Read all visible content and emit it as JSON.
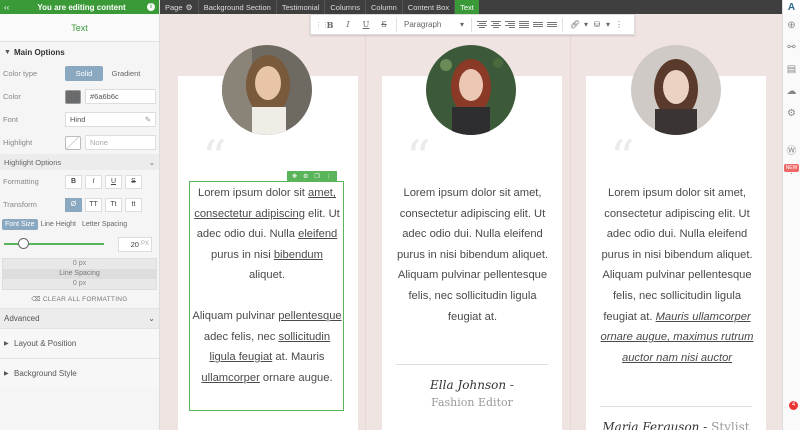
{
  "editing_bar": {
    "text": "You are editing content"
  },
  "panel": {
    "title": "Text",
    "main_options": "Main Options",
    "color_type_label": "Color type",
    "color_type_solid": "Solid",
    "color_type_gradient": "Gradient",
    "color_label": "Color",
    "color_value": "#6a6b6c",
    "font_label": "Font",
    "font_value": "Hind",
    "highlight_label": "Highlight",
    "highlight_value": "None",
    "highlight_options": "Highlight Options",
    "formatting_label": "Formatting",
    "formatting_buttons": [
      "B",
      "I",
      "U",
      "S"
    ],
    "transform_label": "Transform",
    "transform_buttons": [
      "Ø",
      "TT",
      "Tt",
      "tt"
    ],
    "tab_font_size": "Font Size",
    "tab_line_height": "Line Height",
    "tab_letter_spacing": "Letter Spacing",
    "font_size_value": "20",
    "font_size_unit": "PX",
    "spacing_top": "0 px",
    "line_spacing": "Line Spacing",
    "spacing_bottom": "0 px",
    "clear_formatting": "CLEAR ALL FORMATTING",
    "advanced": "Advanced",
    "layout_position": "Layout & Position",
    "background_style": "Background Style"
  },
  "breadcrumb": {
    "items": [
      "Page",
      "Background Section",
      "Testimonial",
      "Columns",
      "Column",
      "Content Box",
      "Text"
    ]
  },
  "text_toolbar": {
    "buttons": [
      "B",
      "I",
      "U",
      "S"
    ],
    "paragraph": "Paragraph"
  },
  "testimonials": [
    {
      "segments": [
        {
          "t": "Lorem ipsum dolor sit "
        },
        {
          "t": "amet,",
          "u": true
        },
        {
          "t": " "
        },
        {
          "t": "consectetur adipiscing",
          "u": true
        },
        {
          "t": " elit. Ut adec odio dui. Nulla "
        },
        {
          "t": "eleifend",
          "u": true
        },
        {
          "t": " purus in nisi "
        },
        {
          "t": "bibendum",
          "u": true
        },
        {
          "t": " aliquet."
        }
      ],
      "segments2": [
        {
          "t": "Aliquam pulvinar "
        },
        {
          "t": "pellentesque",
          "u": true
        },
        {
          "t": " adec felis, nec "
        },
        {
          "t": "sollicitudin ligula feugiat",
          "u": true
        },
        {
          "t": " at. Mauris "
        },
        {
          "t": "ullamcorper",
          "u": true
        },
        {
          "t": " ornare augue."
        }
      ]
    },
    {
      "text": "Lorem ipsum dolor sit amet, consectetur adipiscing elit. Ut adec odio dui. Nulla eleifend purus in nisi bibendum aliquet. Aliquam pulvinar pellentesque felis, nec sollicitudin ligula feugiat at.",
      "name": "Ella Johnson -",
      "role": "Fashion Editor"
    },
    {
      "text": "Lorem ipsum dolor sit amet, consectetur adipiscing elit. Ut adec odio dui. Nulla eleifend purus in nisi bibendum aliquet. Aliquam pulvinar pellentesque felis, nec sollicitudin ligula feugiat at.",
      "italic": "Mauris ullamcorper ornare augue, maximus rutrum auctor nam nisi auctor",
      "name": "Maria Ferguson -",
      "role": "Stylist"
    }
  ],
  "right_toolbar": {
    "logo": "A",
    "badge": "NEW",
    "notify_count": "4"
  },
  "colors": {
    "green": "#3a9a38",
    "active_blue": "#8aa8c0",
    "canvas_bg": "#f0e4e2"
  }
}
